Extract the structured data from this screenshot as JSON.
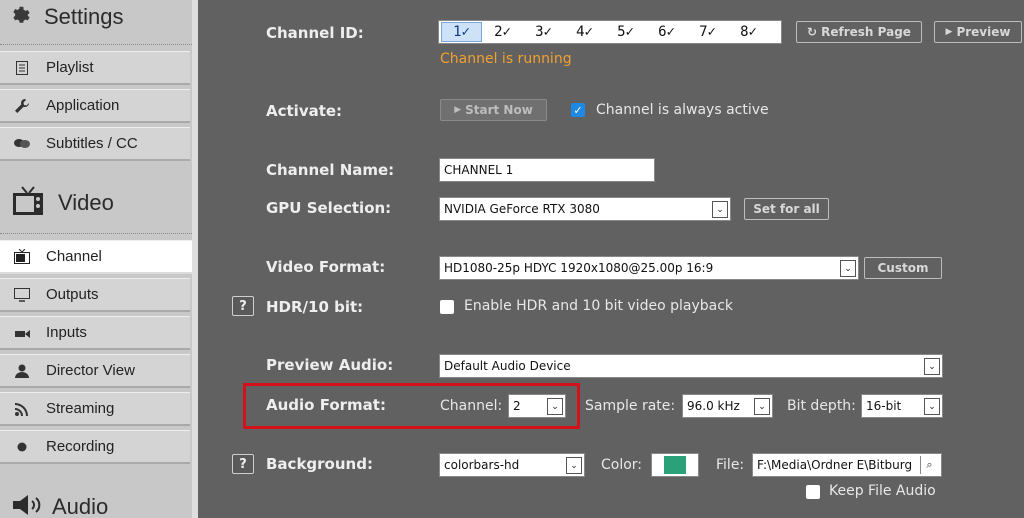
{
  "sidebar": {
    "settings_title": "Settings",
    "settings_items": [
      {
        "label": "Playlist",
        "icon": "playlist-icon"
      },
      {
        "label": "Application",
        "icon": "wrench-icon"
      },
      {
        "label": "Subtitles / CC",
        "icon": "subtitles-icon"
      }
    ],
    "video_title": "Video",
    "video_items": [
      {
        "label": "Channel",
        "icon": "tv-icon",
        "active": true
      },
      {
        "label": "Outputs",
        "icon": "monitor-icon"
      },
      {
        "label": "Inputs",
        "icon": "input-icon"
      },
      {
        "label": "Director View",
        "icon": "user-icon"
      },
      {
        "label": "Streaming",
        "icon": "rss-icon"
      },
      {
        "label": "Recording",
        "icon": "record-icon"
      }
    ],
    "audio_title": "Audio"
  },
  "channel_id": {
    "label": "Channel ID:",
    "channels": [
      "1✓",
      "2✓",
      "3✓",
      "4✓",
      "5✓",
      "6✓",
      "7✓",
      "8✓"
    ],
    "selected": "1✓",
    "status": "Channel is running",
    "refresh_label": "Refresh Page",
    "preview_label": "Preview"
  },
  "activate": {
    "label": "Activate:",
    "start_label": "Start Now",
    "always_active_label": "Channel is always active",
    "always_active_checked": true
  },
  "channel_name": {
    "label": "Channel Name:",
    "value": "CHANNEL 1"
  },
  "gpu": {
    "label": "GPU Selection:",
    "value": "NVIDIA GeForce RTX 3080",
    "set_all_label": "Set for all"
  },
  "video_format": {
    "label": "Video Format:",
    "value": "HD1080-25p HDYC 1920x1080@25.00p 16:9",
    "custom_label": "Custom"
  },
  "hdr": {
    "help": "?",
    "label": "HDR/10 bit:",
    "checkbox_label": "Enable HDR and 10 bit video playback",
    "checked": false
  },
  "preview_audio": {
    "label": "Preview Audio:",
    "value": "Default Audio Device"
  },
  "audio_format": {
    "label": "Audio Format:",
    "channel_label": "Channel:",
    "channel_value": "2",
    "sample_rate_label": "Sample rate:",
    "sample_rate_value": "96.0 kHz",
    "bit_depth_label": "Bit depth:",
    "bit_depth_value": "16-bit"
  },
  "background": {
    "help": "?",
    "label": "Background:",
    "value": "colorbars-hd",
    "color_label": "Color:",
    "color_value": "#2aa178",
    "file_label": "File:",
    "file_value": "F:\\Media\\Ordner E\\Bitburg",
    "keep_audio_label": "Keep File Audio",
    "keep_audio_checked": false
  },
  "colors": {
    "background": "#616161",
    "status": "#f0a030",
    "highlight": "#d3111a"
  }
}
